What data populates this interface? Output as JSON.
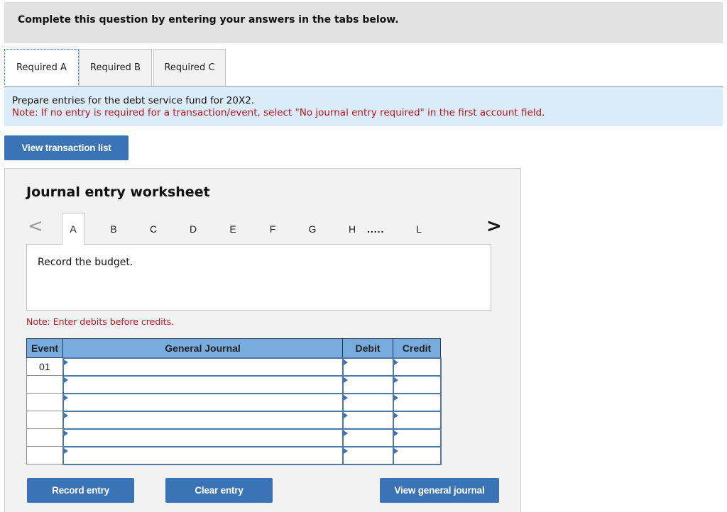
{
  "header": {
    "title": "Complete this question by entering your answers in the tabs below."
  },
  "required_tabs": [
    {
      "label": "Required A",
      "active": true
    },
    {
      "label": "Required B",
      "active": false
    },
    {
      "label": "Required C",
      "active": false
    }
  ],
  "instructions": {
    "prompt": "Prepare entries for the debt service fund for 20X2.",
    "note": "Note: If no entry is required for a transaction/event, select \"No journal entry required\" in the first account field."
  },
  "buttons": {
    "view_transaction_list": "View transaction list",
    "record_entry": "Record entry",
    "clear_entry": "Clear entry",
    "view_general_journal": "View general journal"
  },
  "worksheet": {
    "title": "Journal entry worksheet",
    "nav": {
      "prev_icon": "chevron-left-icon",
      "next_icon": "chevron-right-icon",
      "prev_glyph": "<",
      "next_glyph": ">",
      "letters": [
        "A",
        "B",
        "C",
        "D",
        "E",
        "F",
        "G",
        "H"
      ],
      "ellipsis": ".....",
      "last_letter": "L",
      "active": "A"
    },
    "description": "Record the budget.",
    "note": "Note: Enter debits before credits.",
    "table": {
      "headers": {
        "event": "Event",
        "general_journal": "General Journal",
        "debit": "Debit",
        "credit": "Credit"
      },
      "rows": [
        {
          "event": "01",
          "account": "",
          "debit": "",
          "credit": ""
        },
        {
          "event": "",
          "account": "",
          "debit": "",
          "credit": ""
        },
        {
          "event": "",
          "account": "",
          "debit": "",
          "credit": ""
        },
        {
          "event": "",
          "account": "",
          "debit": "",
          "credit": ""
        },
        {
          "event": "",
          "account": "",
          "debit": "",
          "credit": ""
        },
        {
          "event": "",
          "account": "",
          "debit": "",
          "credit": ""
        }
      ]
    }
  },
  "colors": {
    "accent_button": "#3a74b6",
    "table_header": "#78acde",
    "note_red": "#b8141c",
    "instruction_bg": "#dcebf8"
  }
}
